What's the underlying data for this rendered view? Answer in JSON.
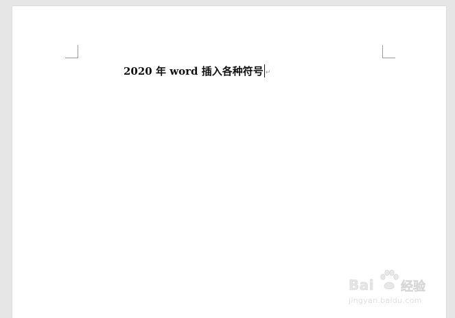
{
  "document": {
    "line1": "2020 年 word 插入各种符号",
    "paragraph_mark": "↵"
  },
  "watermark": {
    "logo_text": "Bai  ",
    "logo_suffix": "经验",
    "url": "jingyan.baidu.com"
  },
  "colors": {
    "workspace": "#e6e6e6",
    "page": "#ffffff",
    "margin_marks": "#9a9a9a",
    "text": "#111111"
  }
}
